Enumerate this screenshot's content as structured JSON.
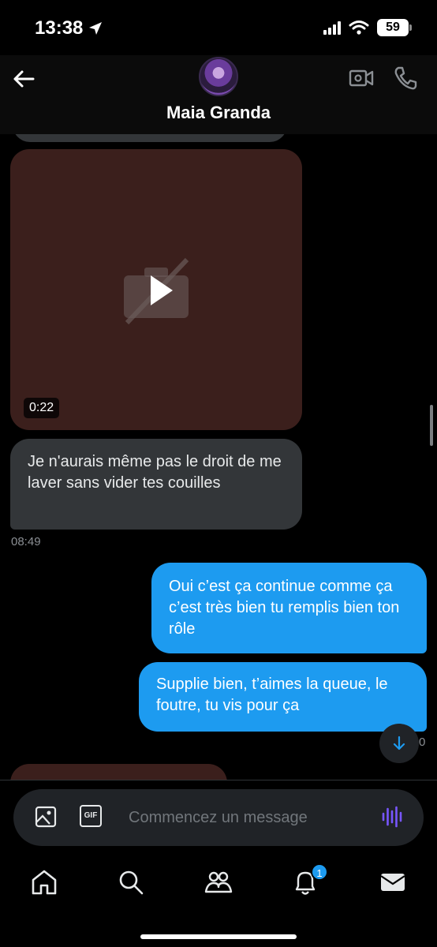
{
  "status_bar": {
    "time": "13:38",
    "battery": "59"
  },
  "header": {
    "contact_name": "Maia Granda"
  },
  "messages": {
    "video": {
      "duration": "0:22"
    },
    "incoming": {
      "text": "Je n'aurais même pas le droit de me laver sans vider tes couilles",
      "timestamp": "08:49"
    },
    "outgoing": [
      {
        "text": "Oui c’est ça continue comme ça c’est très bien tu remplis bien ton rôle"
      },
      {
        "text": "Supplie bien, t’aimes la queue, le foutre, tu vis pour ça"
      }
    ],
    "partial_timestamp": "0"
  },
  "composer": {
    "placeholder": "Commencez un message",
    "gif_label": "GIF"
  },
  "tabbar": {
    "notifications_badge": "1"
  },
  "colors": {
    "accent": "#1d9bf0",
    "incoming_bubble": "#333639",
    "video_bg": "#3b1f1c",
    "voice_icon": "#7856ff"
  }
}
